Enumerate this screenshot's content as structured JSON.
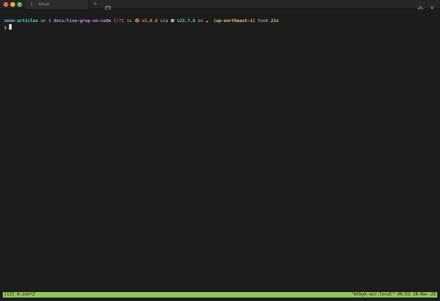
{
  "window": {
    "tab": {
      "number": "1",
      "title": "tmux"
    },
    "new_tab_label": "+"
  },
  "terminal": {
    "prompt_line": {
      "dir": "zenn-articles",
      "on1": " on ",
      "branch_icon": "ᚼ",
      "branch": " docs/live-grep-on-code",
      "status": " [!?]",
      "is": " is ",
      "package_icon": "package-icon",
      "version": " v1.0.0",
      "via": " via ",
      "node_icon": "⬢",
      "node_version": " v23.7.0",
      "on2": " on ",
      "cloud_icon": "☁",
      "aws_region": "  (ap-northeast-1)",
      "took": " took ",
      "duration": "22s"
    },
    "input_line": {
      "prompt_char": "❯"
    }
  },
  "tmux_status": {
    "left": "[13] 0:zsh*Z",
    "right": "\"mtbyk-air.local\" 00:53 18-Mar-25"
  },
  "colors": {
    "status_bar": "#93c65c",
    "background": "#1c1c1c"
  }
}
